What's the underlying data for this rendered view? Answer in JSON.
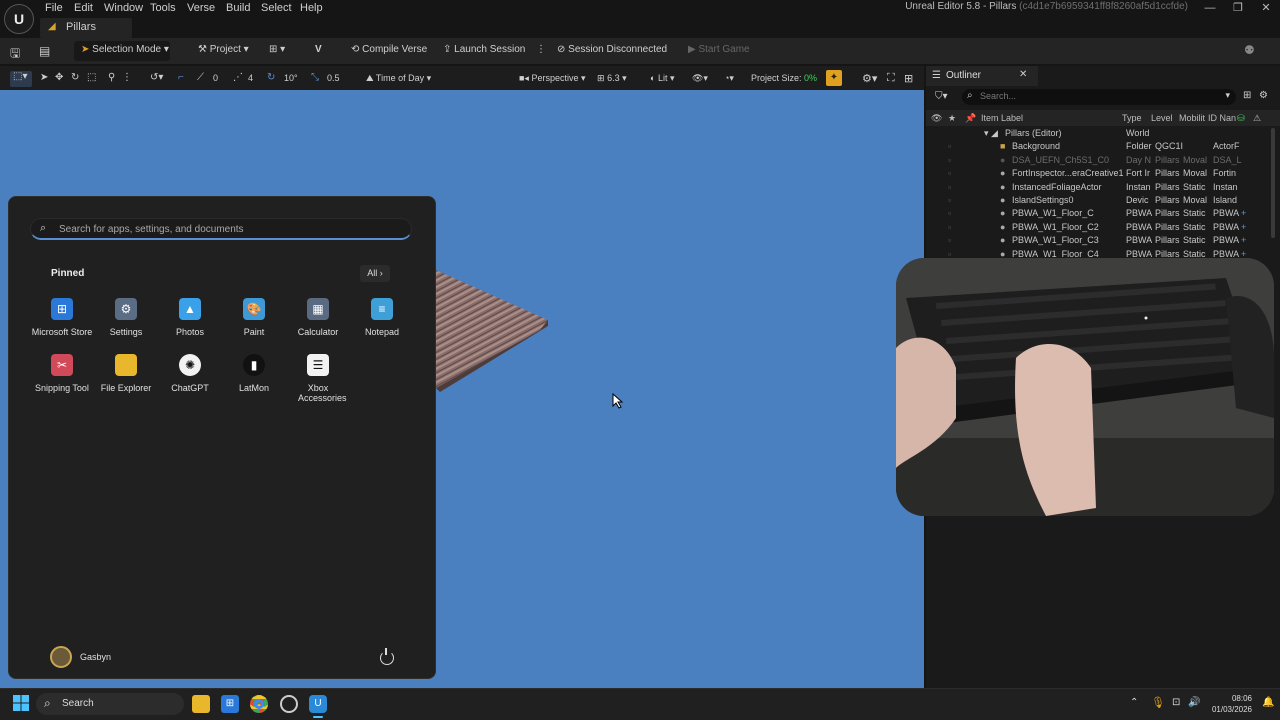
{
  "titlebar": {
    "logo": "unreal-engine-logo",
    "menu": [
      "File",
      "Edit",
      "Window",
      "Tools",
      "Verse",
      "Build",
      "Select",
      "Help"
    ],
    "window_title": "Unreal Editor 5.8 - Pillars",
    "window_hash": "(c4d1e7b6959341ff8f8260af5d1ccfde)",
    "tab_label": "Pillars"
  },
  "toolbar": {
    "selection_mode": "Selection Mode",
    "project": "Project",
    "compile_verse": "Compile Verse",
    "launch_session": "Launch Session",
    "session_status": "Session Disconnected",
    "start_game": "Start Game"
  },
  "viewport_bar": {
    "snap_translate": "0",
    "grid_value": "4",
    "rotation_snap": "10°",
    "scale_snap": "0.5",
    "time_of_day": "Time of Day",
    "perspective": "Perspective",
    "camera_speed": "6.3",
    "view_mode": "Lit",
    "project_size_label": "Project Size:",
    "project_size_value": "0%"
  },
  "outliner": {
    "tab_label": "Outliner",
    "search_placeholder": "Search...",
    "headers": [
      "Item Label",
      "Type",
      "Level",
      "Mobilit",
      "ID Nan"
    ],
    "rows": [
      {
        "label": "Pillars (Editor)",
        "type": "World",
        "level": "",
        "mobility": "",
        "id": "",
        "dim": false
      },
      {
        "label": "Background",
        "type": "Folder",
        "level": "QGC1I",
        "mobility": "",
        "id": "ActorF",
        "dim": false
      },
      {
        "label": "DSA_UEFN_Ch5S1_C0",
        "type": "Day N",
        "level": "Pillars",
        "mobility": "Moval",
        "id": "DSA_L",
        "dim": true
      },
      {
        "label": "FortInspector...eraCreative1",
        "type": "Fort Ir",
        "level": "Pillars",
        "mobility": "Moval",
        "id": "Fortin",
        "dim": false
      },
      {
        "label": "InstancedFoliageActor",
        "type": "Instan",
        "level": "Pillars",
        "mobility": "Static",
        "id": "Instan",
        "dim": false
      },
      {
        "label": "IslandSettings0",
        "type": "Devic",
        "level": "Pillars",
        "mobility": "Moval",
        "id": "Island",
        "dim": false
      },
      {
        "label": "PBWA_W1_Floor_C",
        "type": "PBWA",
        "level": "Pillars",
        "mobility": "Static",
        "id": "PBWA",
        "dim": false
      },
      {
        "label": "PBWA_W1_Floor_C2",
        "type": "PBWA",
        "level": "Pillars",
        "mobility": "Static",
        "id": "PBWA",
        "dim": false
      },
      {
        "label": "PBWA_W1_Floor_C3",
        "type": "PBWA",
        "level": "Pillars",
        "mobility": "Static",
        "id": "PBWA",
        "dim": false
      },
      {
        "label": "PBWA_W1_Floor_C4",
        "type": "PBWA",
        "level": "Pillars",
        "mobility": "Static",
        "id": "PBWA",
        "dim": false
      }
    ]
  },
  "start_menu": {
    "search_placeholder": "Search for apps, settings, and documents",
    "pinned_title": "Pinned",
    "all_button": "All",
    "apps": [
      {
        "label": "Microsoft Store",
        "icon": "store-icon",
        "color": "#2a79d8"
      },
      {
        "label": "Settings",
        "icon": "gear-icon",
        "color": "#5b6c85"
      },
      {
        "label": "Photos",
        "icon": "photos-icon",
        "color": "#3aa0e8"
      },
      {
        "label": "Paint",
        "icon": "paint-icon",
        "color": "#3d9ad6"
      },
      {
        "label": "Calculator",
        "icon": "calculator-icon",
        "color": "#5a6a80"
      },
      {
        "label": "Notepad",
        "icon": "notepad-icon",
        "color": "#3fa0d8"
      },
      {
        "label": "Snipping Tool",
        "icon": "snipping-tool-icon",
        "color": "#d04a5a"
      },
      {
        "label": "File Explorer",
        "icon": "folder-icon",
        "color": "#e8b72c"
      },
      {
        "label": "ChatGPT",
        "icon": "chatgpt-icon",
        "color": "#f2f2f2"
      },
      {
        "label": "LatMon",
        "icon": "latmon-icon",
        "color": "#111111"
      },
      {
        "label": "Xbox Accessories",
        "icon": "xbox-accessories-icon",
        "color": "#f2f2f2"
      }
    ],
    "user_name": "Gasbyn"
  },
  "taskbar": {
    "search_label": "Search",
    "time": "08:06",
    "date": "01/03/2026"
  }
}
